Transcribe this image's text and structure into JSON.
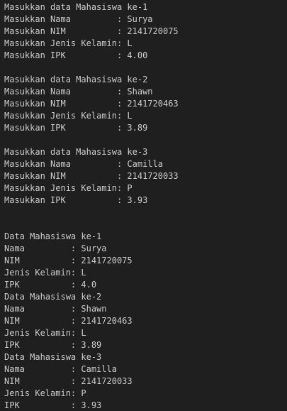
{
  "terminal": {
    "lines": [
      "Masukkan data Mahasiswa ke-1",
      "Masukkan Nama         : Surya",
      "Masukkan NIM          : 2141720075",
      "Masukkan Jenis Kelamin: L",
      "Masukkan IPK          : 4.00",
      "",
      "Masukkan data Mahasiswa ke-2",
      "Masukkan Nama         : Shawn",
      "Masukkan NIM          : 2141720463",
      "Masukkan Jenis Kelamin: L",
      "Masukkan IPK          : 3.89",
      "",
      "Masukkan data Mahasiswa ke-3",
      "Masukkan Nama         : Camilla",
      "Masukkan NIM          : 2141720033",
      "Masukkan Jenis Kelamin: P",
      "Masukkan IPK          : 3.93",
      "",
      "",
      "Data Mahasiswa ke-1",
      "Nama         : Surya",
      "NIM          : 2141720075",
      "Jenis Kelamin: L",
      "IPK          : 4.0",
      "Data Mahasiswa ke-2",
      "Nama         : Shawn",
      "NIM          : 2141720463",
      "Jenis Kelamin: L",
      "IPK          : 3.89",
      "Data Mahasiswa ke-3",
      "Nama         : Camilla",
      "NIM          : 2141720033",
      "Jenis Kelamin: P",
      "IPK          : 3.93"
    ]
  }
}
